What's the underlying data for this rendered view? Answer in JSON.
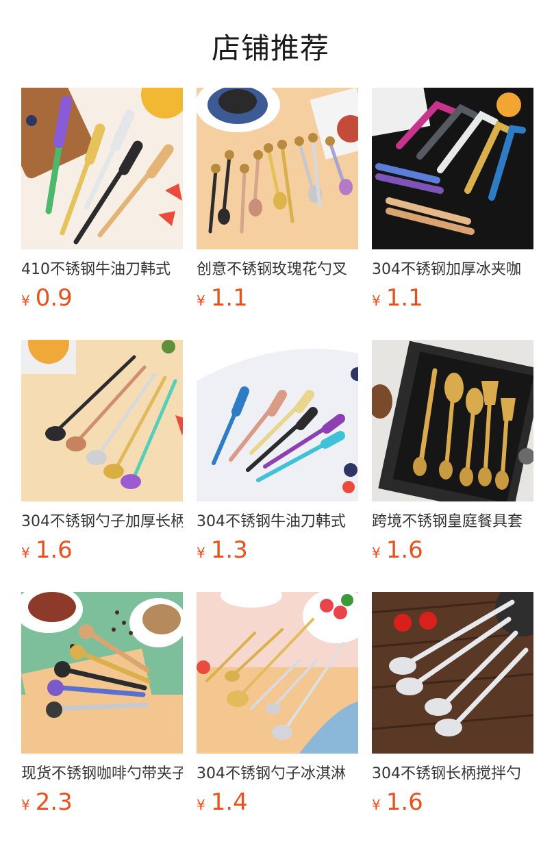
{
  "header": {
    "title": "店铺推荐"
  },
  "currency": "¥",
  "products": [
    {
      "title": "410不锈钢牛油刀韩式",
      "price": "0.9",
      "image": "butter-knives-colorful",
      "bg": "#f4e9dc"
    },
    {
      "title": "创意不锈钢玫瑰花勺叉",
      "price": "1.1",
      "image": "rose-spoons-forks",
      "bg": "#f6d4a8"
    },
    {
      "title": "304不锈钢加厚冰夹咖",
      "price": "1.1",
      "image": "ice-tongs",
      "bg": "#1b1b1b"
    },
    {
      "title": "304不锈钢勺子加厚长柄",
      "price": "1.6",
      "image": "long-spoons-colorful",
      "bg": "#f5ddb7"
    },
    {
      "title": "304不锈钢牛油刀韩式",
      "price": "1.3",
      "image": "butter-knives-pastel",
      "bg": "#eef0f6"
    },
    {
      "title": "跨境不锈钢皇庭餐具套",
      "price": "1.6",
      "image": "gold-cutlery-gift-box",
      "bg": "#e8e6e3"
    },
    {
      "title": "现货不锈钢咖啡勺带夹子",
      "price": "2.3",
      "image": "coffee-scoop-clips",
      "bg": "#f3c58e"
    },
    {
      "title": "304不锈钢勺子冰淇淋",
      "price": "1.4",
      "image": "dessert-spoons-forks",
      "bg": "#f7d9d2"
    },
    {
      "title": "304不锈钢长柄搅拌勺",
      "price": "1.6",
      "image": "long-silver-spoons",
      "bg": "#5a3a28"
    }
  ]
}
